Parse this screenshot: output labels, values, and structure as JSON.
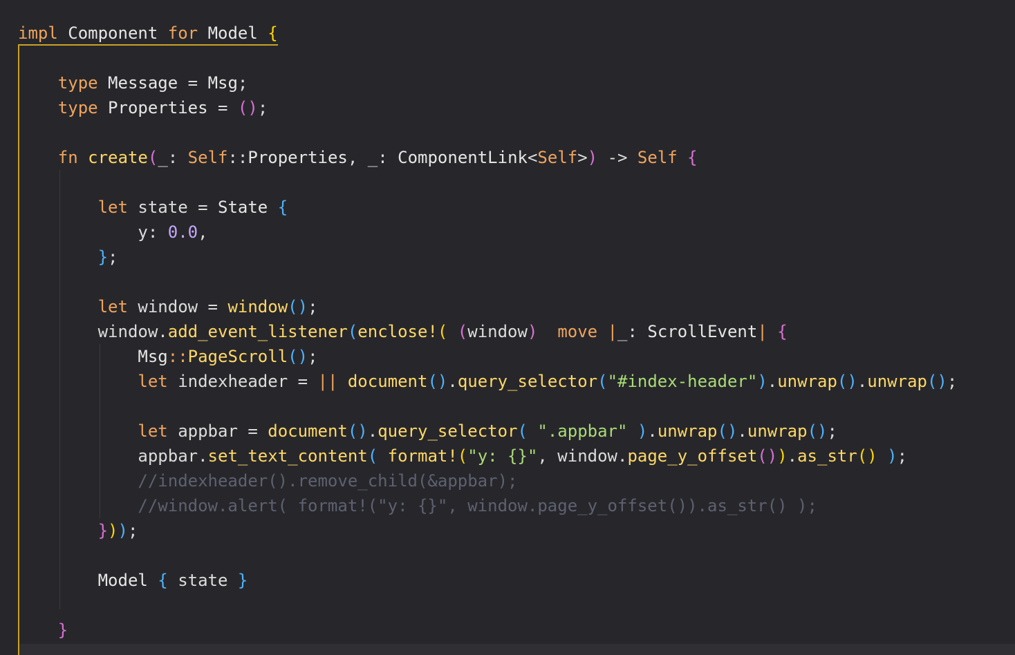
{
  "editor": {
    "language": "rust",
    "lines": [
      {
        "id": "l1",
        "indent": 0,
        "tokens": [
          {
            "t": "impl",
            "c": "kw"
          },
          {
            "t": " "
          },
          {
            "t": "Component",
            "c": "ty"
          },
          {
            "t": " "
          },
          {
            "t": "for",
            "c": "kw"
          },
          {
            "t": " "
          },
          {
            "t": "Model",
            "c": "ty"
          },
          {
            "t": " "
          },
          {
            "t": "{",
            "c": "b1"
          }
        ]
      },
      {
        "id": "l3",
        "indent": 4,
        "tokens": [
          {
            "t": "type",
            "c": "kw"
          },
          {
            "t": " "
          },
          {
            "t": "Message",
            "c": "ty"
          },
          {
            "t": " = ",
            "c": "pun"
          },
          {
            "t": "Msg",
            "c": "ty"
          },
          {
            "t": ";",
            "c": "pun"
          }
        ]
      },
      {
        "id": "l4",
        "indent": 4,
        "tokens": [
          {
            "t": "type",
            "c": "kw"
          },
          {
            "t": " "
          },
          {
            "t": "Properties",
            "c": "ty"
          },
          {
            "t": " = ",
            "c": "pun"
          },
          {
            "t": "()",
            "c": "b2"
          },
          {
            "t": ";",
            "c": "pun"
          }
        ]
      },
      {
        "id": "l6",
        "indent": 4,
        "tokens": [
          {
            "t": "fn",
            "c": "kw"
          },
          {
            "t": " "
          },
          {
            "t": "create",
            "c": "fn"
          },
          {
            "t": "(",
            "c": "b2"
          },
          {
            "t": "_: ",
            "c": "pun"
          },
          {
            "t": "Self",
            "c": "self"
          },
          {
            "t": "::",
            "c": "pun"
          },
          {
            "t": "Properties",
            "c": "ty"
          },
          {
            "t": ", _: ",
            "c": "pun"
          },
          {
            "t": "ComponentLink",
            "c": "ty"
          },
          {
            "t": "<",
            "c": "pun"
          },
          {
            "t": "Self",
            "c": "self"
          },
          {
            "t": ">",
            "c": "pun"
          },
          {
            "t": ")",
            "c": "b2"
          },
          {
            "t": " -> ",
            "c": "pun"
          },
          {
            "t": "Self",
            "c": "self"
          },
          {
            "t": " "
          },
          {
            "t": "{",
            "c": "b2"
          }
        ]
      },
      {
        "id": "l8",
        "indent": 8,
        "tokens": [
          {
            "t": "let",
            "c": "kw"
          },
          {
            "t": " state = ",
            "c": "pun"
          },
          {
            "t": "State",
            "c": "ty"
          },
          {
            "t": " "
          },
          {
            "t": "{",
            "c": "b3"
          }
        ]
      },
      {
        "id": "l9",
        "indent": 12,
        "tokens": [
          {
            "t": "y: ",
            "c": "pun"
          },
          {
            "t": "0.0",
            "c": "num"
          },
          {
            "t": ",",
            "c": "pun"
          }
        ]
      },
      {
        "id": "l10",
        "indent": 8,
        "tokens": [
          {
            "t": "}",
            "c": "b3"
          },
          {
            "t": ";",
            "c": "pun"
          }
        ]
      },
      {
        "id": "l12",
        "indent": 8,
        "tokens": [
          {
            "t": "let",
            "c": "kw"
          },
          {
            "t": " window = ",
            "c": "pun"
          },
          {
            "t": "window",
            "c": "fn"
          },
          {
            "t": "()",
            "c": "b3"
          },
          {
            "t": ";",
            "c": "pun"
          }
        ]
      },
      {
        "id": "l13",
        "indent": 8,
        "tokens": [
          {
            "t": "window.",
            "c": "pun"
          },
          {
            "t": "add_event_listener",
            "c": "fn"
          },
          {
            "t": "(",
            "c": "b3"
          },
          {
            "t": "enclose!",
            "c": "mac"
          },
          {
            "t": "(",
            "c": "b1"
          },
          {
            "t": " "
          },
          {
            "t": "(",
            "c": "b2"
          },
          {
            "t": "window",
            "c": "pun"
          },
          {
            "t": ")",
            "c": "b2"
          },
          {
            "t": "  "
          },
          {
            "t": "move",
            "c": "kw"
          },
          {
            "t": " "
          },
          {
            "t": "|",
            "c": "op"
          },
          {
            "t": "_: ",
            "c": "pun"
          },
          {
            "t": "ScrollEvent",
            "c": "ty"
          },
          {
            "t": "|",
            "c": "op"
          },
          {
            "t": " "
          },
          {
            "t": "{",
            "c": "b2"
          }
        ]
      },
      {
        "id": "l14",
        "indent": 12,
        "tokens": [
          {
            "t": "Msg",
            "c": "ty"
          },
          {
            "t": "::",
            "c": "op"
          },
          {
            "t": "PageScroll",
            "c": "fn"
          },
          {
            "t": "()",
            "c": "b3"
          },
          {
            "t": ";",
            "c": "pun"
          }
        ]
      },
      {
        "id": "l15",
        "indent": 12,
        "tokens": [
          {
            "t": "let",
            "c": "kw"
          },
          {
            "t": " indexheader = ",
            "c": "pun"
          },
          {
            "t": "||",
            "c": "op"
          },
          {
            "t": " "
          },
          {
            "t": "document",
            "c": "fn"
          },
          {
            "t": "()",
            "c": "b3"
          },
          {
            "t": ".",
            "c": "pun"
          },
          {
            "t": "query_selector",
            "c": "fn"
          },
          {
            "t": "(",
            "c": "b3"
          },
          {
            "t": "\"#index-header\"",
            "c": "str"
          },
          {
            "t": ")",
            "c": "b3"
          },
          {
            "t": ".",
            "c": "pun"
          },
          {
            "t": "unwrap",
            "c": "fn"
          },
          {
            "t": "()",
            "c": "b3"
          },
          {
            "t": ".",
            "c": "pun"
          },
          {
            "t": "unwrap",
            "c": "fn"
          },
          {
            "t": "()",
            "c": "b3"
          },
          {
            "t": ";",
            "c": "pun"
          }
        ]
      },
      {
        "id": "l17",
        "indent": 12,
        "tokens": [
          {
            "t": "let",
            "c": "kw"
          },
          {
            "t": " appbar = ",
            "c": "pun"
          },
          {
            "t": "document",
            "c": "fn"
          },
          {
            "t": "()",
            "c": "b3"
          },
          {
            "t": ".",
            "c": "pun"
          },
          {
            "t": "query_selector",
            "c": "fn"
          },
          {
            "t": "(",
            "c": "b3"
          },
          {
            "t": " "
          },
          {
            "t": "\".appbar\"",
            "c": "str"
          },
          {
            "t": " "
          },
          {
            "t": ")",
            "c": "b3"
          },
          {
            "t": ".",
            "c": "pun"
          },
          {
            "t": "unwrap",
            "c": "fn"
          },
          {
            "t": "()",
            "c": "b3"
          },
          {
            "t": ".",
            "c": "pun"
          },
          {
            "t": "unwrap",
            "c": "fn"
          },
          {
            "t": "()",
            "c": "b3"
          },
          {
            "t": ";",
            "c": "pun"
          }
        ]
      },
      {
        "id": "l18",
        "indent": 12,
        "tokens": [
          {
            "t": "appbar.",
            "c": "pun"
          },
          {
            "t": "set_text_content",
            "c": "fn"
          },
          {
            "t": "(",
            "c": "b3"
          },
          {
            "t": " "
          },
          {
            "t": "format!",
            "c": "mac"
          },
          {
            "t": "(",
            "c": "b1"
          },
          {
            "t": "\"y: {}\"",
            "c": "str"
          },
          {
            "t": ", window.",
            "c": "pun"
          },
          {
            "t": "page_y_offset",
            "c": "fn"
          },
          {
            "t": "()",
            "c": "b2"
          },
          {
            "t": ")",
            "c": "b1"
          },
          {
            "t": ".",
            "c": "pun"
          },
          {
            "t": "as_str",
            "c": "fn"
          },
          {
            "t": "()",
            "c": "b1"
          },
          {
            "t": " "
          },
          {
            "t": ")",
            "c": "b3"
          },
          {
            "t": ";",
            "c": "pun"
          }
        ]
      },
      {
        "id": "l19",
        "indent": 12,
        "tokens": [
          {
            "t": "//indexheader().remove_child(&appbar);",
            "c": "cm"
          }
        ]
      },
      {
        "id": "l20",
        "indent": 12,
        "tokens": [
          {
            "t": "//window.alert( format!(\"y: {}\", window.page_y_offset()).as_str() );",
            "c": "cm"
          }
        ]
      },
      {
        "id": "l21",
        "indent": 8,
        "tokens": [
          {
            "t": "}",
            "c": "b2"
          },
          {
            "t": ")",
            "c": "b1"
          },
          {
            "t": ")",
            "c": "b3"
          },
          {
            "t": ";",
            "c": "pun"
          }
        ]
      },
      {
        "id": "l23",
        "indent": 8,
        "tokens": [
          {
            "t": "Model",
            "c": "ty"
          },
          {
            "t": " "
          },
          {
            "t": "{",
            "c": "b3"
          },
          {
            "t": " state ",
            "c": "pun"
          },
          {
            "t": "}",
            "c": "b3"
          }
        ]
      },
      {
        "id": "l25",
        "indent": 4,
        "tokens": [
          {
            "t": "}",
            "c": "b2"
          }
        ]
      }
    ]
  }
}
